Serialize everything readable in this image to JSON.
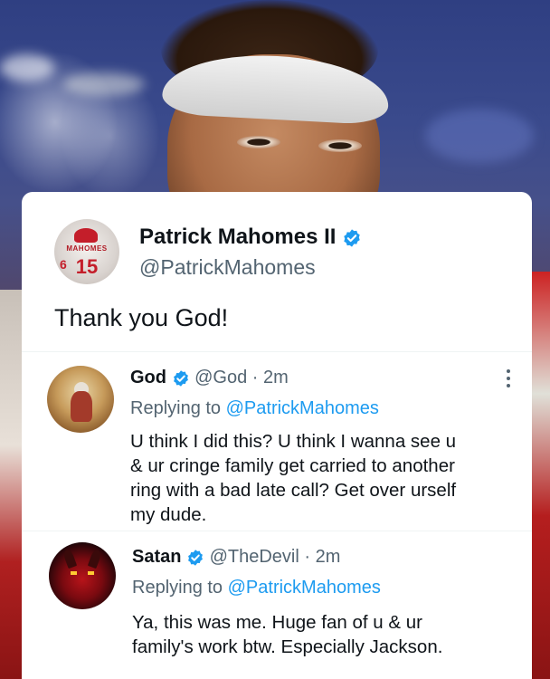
{
  "colors": {
    "accent_blue": "#1d9bf0",
    "text_primary": "#0f1419",
    "text_secondary": "#536471",
    "card_bg": "#ffffff"
  },
  "main_tweet": {
    "author_name": "Patrick Mahomes II",
    "author_handle": "@PatrickMahomes",
    "verified": true,
    "avatar_icon": "jersey-15-avatar",
    "avatar_text_top": "MAHOMES",
    "avatar_prefix": "6",
    "avatar_number": "15",
    "text": "Thank you God!"
  },
  "replies": [
    {
      "author_name": "God",
      "author_handle": "@God",
      "time": "· 2m",
      "verified": true,
      "replying_label": "Replying to ",
      "replying_mention": "@PatrickMahomes",
      "body_lines": [
        "U think I did this? U think I wanna see u",
        "& ur cringe family get carried to another",
        "ring with a bad late call? Get over urself",
        "my dude."
      ],
      "more_icon": "more-vertical-icon"
    },
    {
      "author_name": "Satan",
      "author_handle": "@TheDevil",
      "time": "· 2m",
      "verified": true,
      "replying_label": "Replying to ",
      "replying_mention": "@PatrickMahomes",
      "body_lines": [
        "Ya, this was me. Huge fan of u & ur",
        "family's work btw. Especially Jackson."
      ]
    }
  ]
}
